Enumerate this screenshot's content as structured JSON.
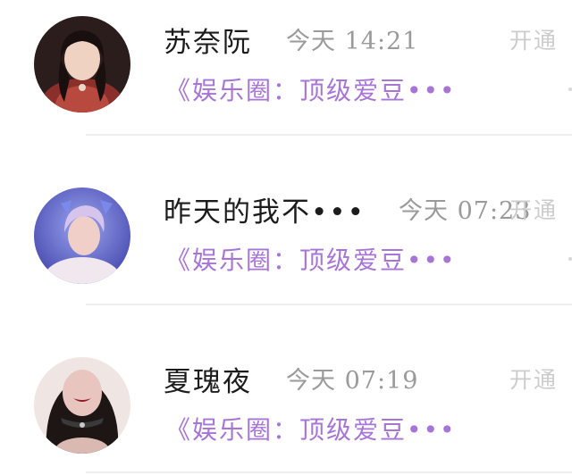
{
  "messages": [
    {
      "name": "苏奈阮",
      "time": "今天 14:21",
      "tag": "开通",
      "snippet": "《娱乐圈：顶级爱豆•••",
      "avatar_icon": "avatar-icon"
    },
    {
      "name": "昨天的我不•••",
      "time": "今天 07:23",
      "tag": "开通",
      "snippet": "《娱乐圈：顶级爱豆•••",
      "avatar_icon": "avatar-icon"
    },
    {
      "name": "夏瑰夜",
      "time": "今天 07:19",
      "tag": "开通",
      "snippet": "《娱乐圈：顶级爱豆•••",
      "avatar_icon": "avatar-icon"
    }
  ],
  "colors": {
    "snippet": "#a675d6",
    "name": "#1c1c1c",
    "time": "#9a9a9a",
    "tag": "#cccccc"
  }
}
